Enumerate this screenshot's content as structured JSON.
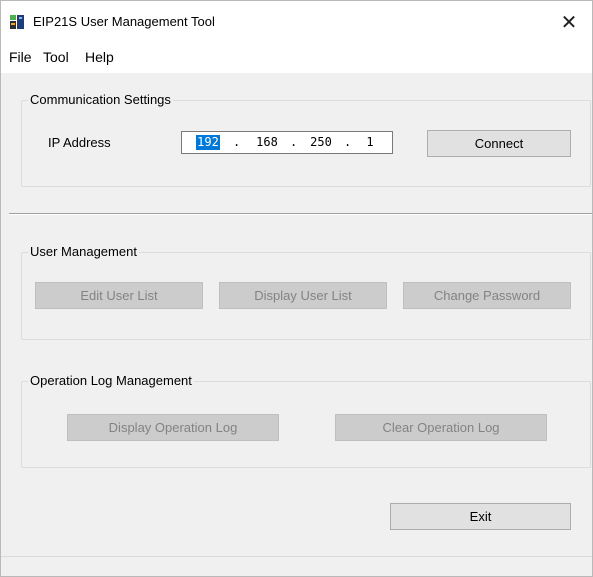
{
  "window": {
    "title": "EIP21S User Management Tool",
    "close_glyph": "✕"
  },
  "menu": [
    "File",
    "Tool",
    "Help"
  ],
  "communication": {
    "legend": "Communication Settings",
    "ip_label": "IP Address",
    "ip_octets": [
      "192",
      "168",
      "250",
      "1"
    ],
    "ip_separator": ".",
    "selected_octet": 0,
    "connect_label": "Connect"
  },
  "user_management": {
    "legend": "User Management",
    "edit_label": "Edit User List",
    "display_label": "Display User List",
    "change_password_label": "Change Password",
    "enabled": false
  },
  "operation_log": {
    "legend": "Operation Log Management",
    "display_label": "Display Operation Log",
    "clear_label": "Clear Operation Log",
    "enabled": false
  },
  "exit_label": "Exit",
  "colors": {
    "selection": "#0078d7",
    "disabled_button": "#cccccc",
    "disabled_text": "#838383"
  },
  "icons": {
    "app": "app-icon",
    "close": "close-icon"
  }
}
